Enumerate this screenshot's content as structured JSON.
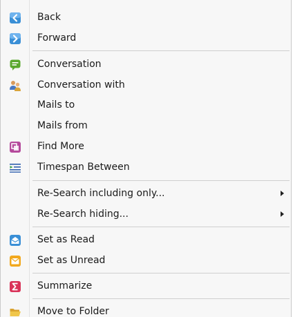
{
  "menu": {
    "items": [
      {
        "label": "Back",
        "icon": "back-arrow-icon"
      },
      {
        "label": "Forward",
        "icon": "forward-arrow-icon"
      },
      {
        "label": "Conversation",
        "icon": "conversation-icon"
      },
      {
        "label": "Conversation with",
        "icon": "people-icon"
      },
      {
        "label": "Mails to",
        "icon": ""
      },
      {
        "label": "Mails from",
        "icon": ""
      },
      {
        "label": "Find More",
        "icon": "find-more-icon"
      },
      {
        "label": "Timespan Between",
        "icon": "timespan-icon"
      },
      {
        "label": "Re-Search including only...",
        "icon": "",
        "submenu": true
      },
      {
        "label": "Re-Search hiding...",
        "icon": "",
        "submenu": true
      },
      {
        "label": "Set as Read",
        "icon": "read-envelope-icon"
      },
      {
        "label": "Set as Unread",
        "icon": "unread-envelope-icon"
      },
      {
        "label": "Summarize",
        "icon": "sigma-icon"
      },
      {
        "label": "Move to Folder",
        "icon": "folder-icon"
      }
    ]
  },
  "colors": {
    "nav_blue": "#3a8fd6",
    "conversation_green": "#5aa82e",
    "find_purple": "#b54a9c",
    "unread_orange": "#f2a81d",
    "sigma_red": "#d9345a",
    "folder_yellow": "#f0c64a"
  }
}
